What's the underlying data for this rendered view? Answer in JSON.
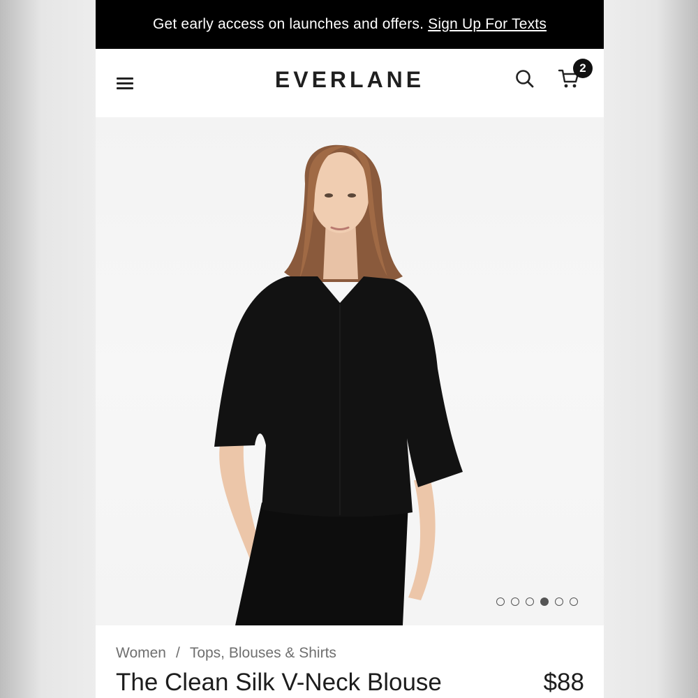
{
  "promo": {
    "text": "Get early access on launches and offers.",
    "link_label": "Sign Up For Texts"
  },
  "header": {
    "logo": "EVERLANE",
    "cart_count": "2",
    "icons": [
      "menu-icon",
      "search-icon",
      "cart-icon"
    ]
  },
  "gallery": {
    "image_count": 6,
    "active_index": 3
  },
  "breadcrumb": {
    "items": [
      "Women",
      "Tops, Blouses & Shirts"
    ],
    "separator": "/"
  },
  "product": {
    "title": "The Clean Silk V-Neck Blouse",
    "price": "$88"
  },
  "colors": {
    "promo_bg": "#000000",
    "text_dark": "#1d1d1d",
    "text_muted": "#6f6f6f",
    "blouse": "#121212"
  }
}
